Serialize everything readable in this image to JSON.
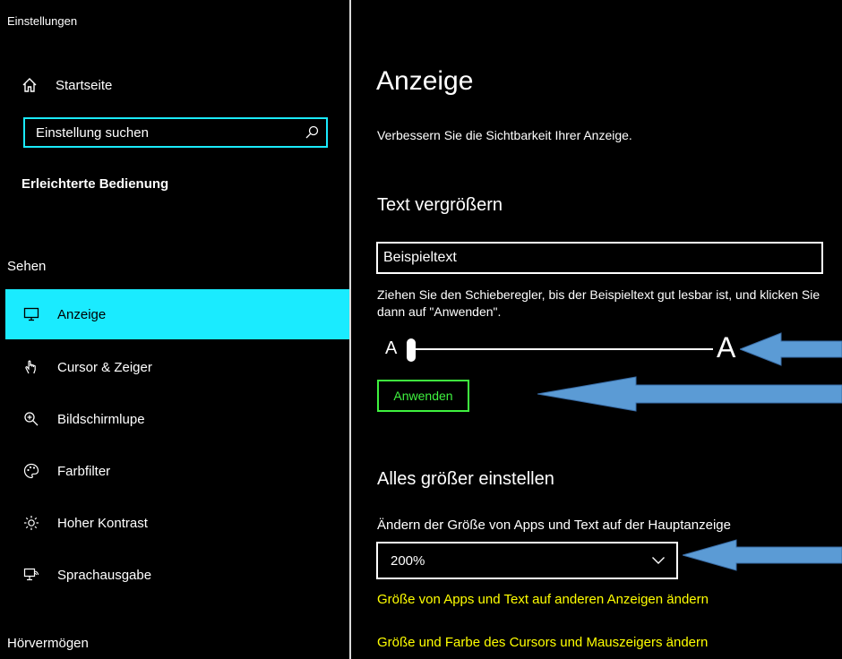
{
  "app": {
    "title": "Einstellungen"
  },
  "sidebar": {
    "home_label": "Startseite",
    "search_value": "Einstellung suchen",
    "section_title": "Erleichterte Bedienung",
    "group_sehen": "Sehen",
    "group_hoeren": "Hörvermögen",
    "items": [
      {
        "label": "Anzeige",
        "icon": "monitor-icon",
        "active": true
      },
      {
        "label": "Cursor & Zeiger",
        "icon": "pointer-icon"
      },
      {
        "label": "Bildschirmlupe",
        "icon": "magnifier-icon"
      },
      {
        "label": "Farbfilter",
        "icon": "palette-icon"
      },
      {
        "label": "Hoher Kontrast",
        "icon": "sun-icon"
      },
      {
        "label": "Sprachausgabe",
        "icon": "narrator-icon"
      }
    ]
  },
  "main": {
    "title": "Anzeige",
    "subtitle": "Verbessern Sie die Sichtbarkeit Ihrer Anzeige.",
    "text_section": {
      "heading": "Text vergrößern",
      "sample_text": "Beispieltext",
      "hint": "Ziehen Sie den Schieberegler, bis der Beispieltext gut lesbar ist, und klicken Sie dann auf \"Anwenden\".",
      "slider_min_label": "A",
      "slider_max_label": "A",
      "slider_value": 0,
      "apply_label": "Anwenden"
    },
    "scale_section": {
      "heading": "Alles größer einstellen",
      "label": "Ändern der Größe von Apps und Text auf der Hauptanzeige",
      "selected": "200%",
      "links": [
        "Größe von Apps und Text auf anderen Anzeigen ändern",
        "Größe und Farbe des Cursors und Mauszeigers ändern"
      ]
    }
  },
  "colors": {
    "accent": "#1aebff",
    "apply_button": "#3ff23f",
    "link": "#ffff00",
    "annotation_arrow": "#5b9bd5"
  }
}
